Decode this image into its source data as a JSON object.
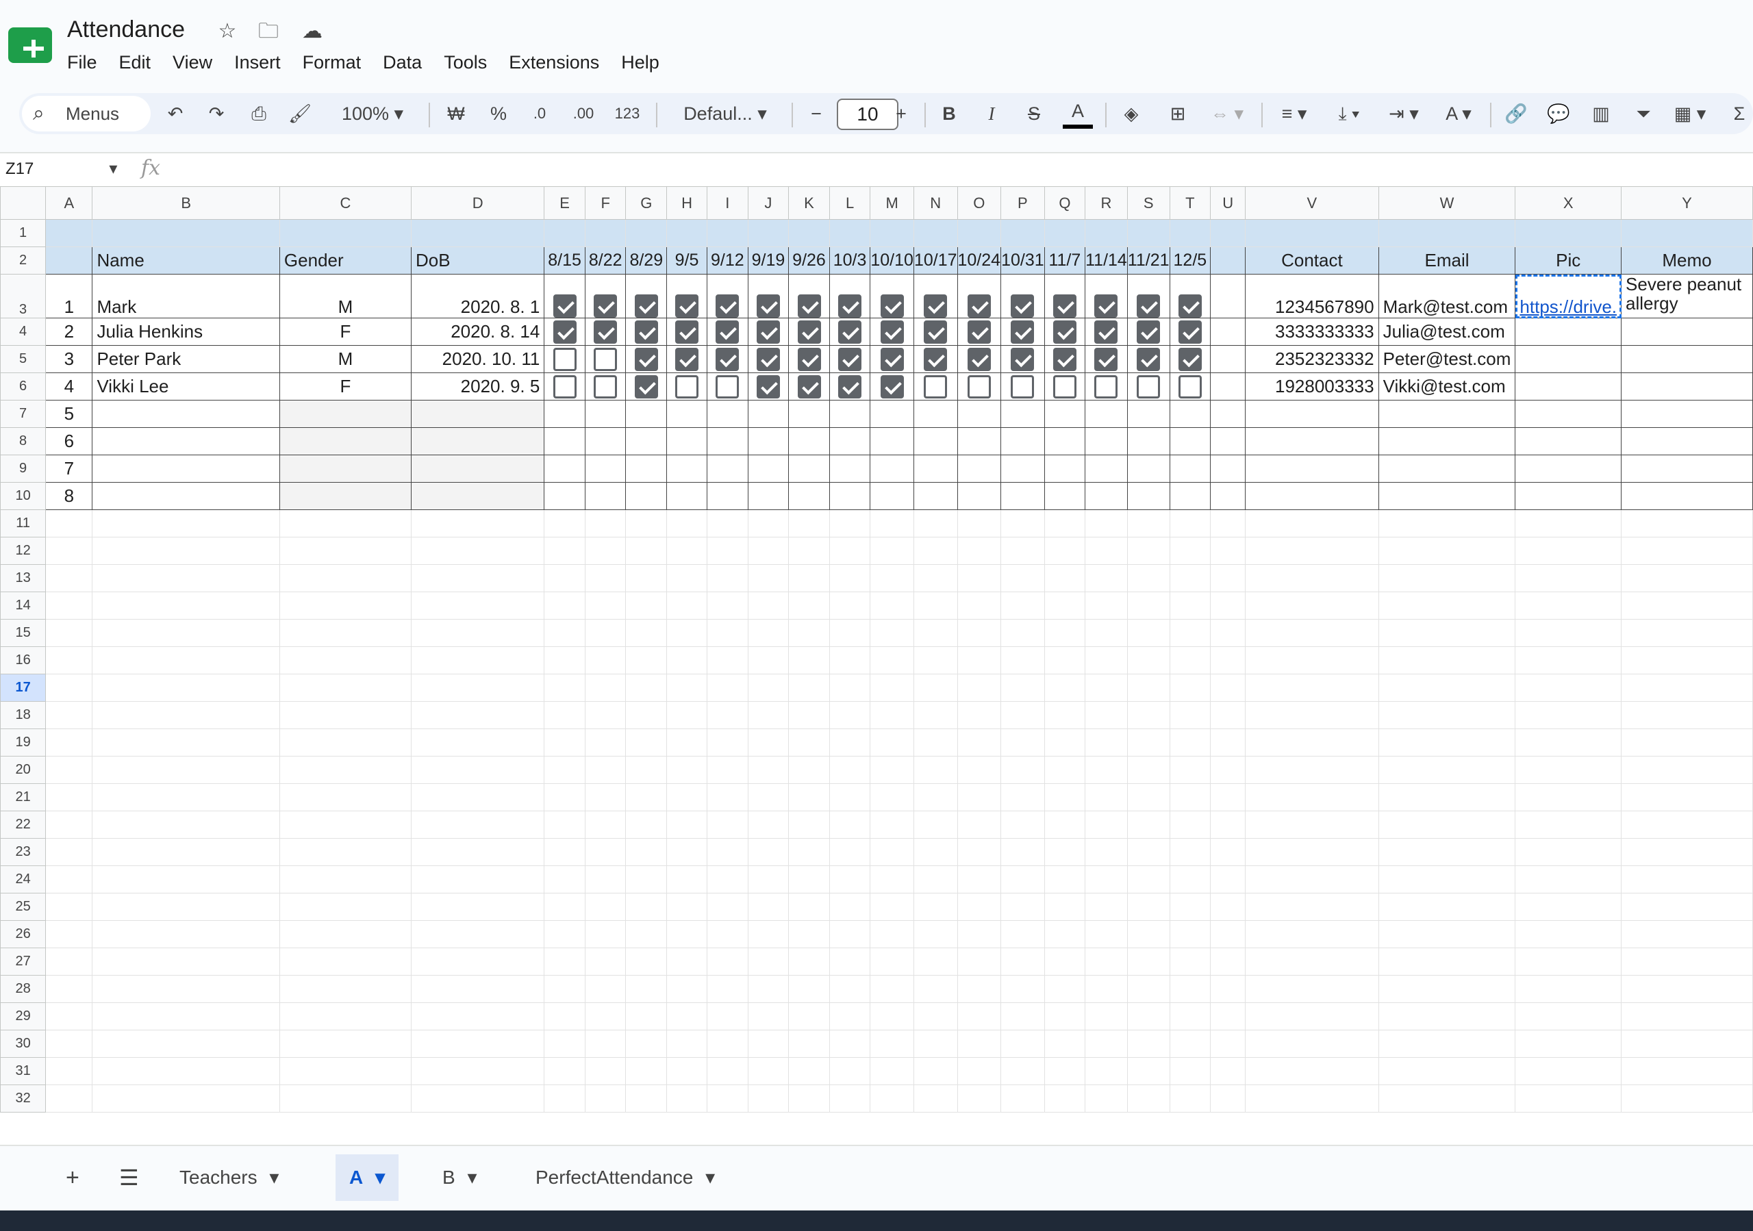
{
  "doc": {
    "title": "Attendance"
  },
  "menu": [
    "File",
    "Edit",
    "View",
    "Insert",
    "Format",
    "Data",
    "Tools",
    "Extensions",
    "Help"
  ],
  "toolbar": {
    "search": "Menus",
    "zoom": "100%",
    "currency": "₩",
    "percent": "%",
    "dec_less": ".0",
    "dec_more": ".00",
    "format_123": "123",
    "font": "Defaul...",
    "font_size": "10",
    "bold": "B",
    "italic": "I",
    "strike": "S",
    "text_color": "A"
  },
  "formula": {
    "cell_ref": "Z17",
    "fx": "fx"
  },
  "columns": [
    "A",
    "B",
    "C",
    "D",
    "E",
    "F",
    "G",
    "H",
    "I",
    "J",
    "K",
    "L",
    "M",
    "N",
    "O",
    "P",
    "Q",
    "R",
    "S",
    "T",
    "U",
    "V",
    "W",
    "X",
    "Y"
  ],
  "header": {
    "name": "Name",
    "gender": "Gender",
    "dob": "DoB",
    "dates": [
      "8/15",
      "8/22",
      "8/29",
      "9/5",
      "9/12",
      "9/19",
      "9/26",
      "10/3",
      "10/10",
      "10/17",
      "10/24",
      "10/31",
      "11/7",
      "11/14",
      "11/21",
      "12/5"
    ],
    "contact": "Contact",
    "email": "Email",
    "pic": "Pic",
    "memo": "Memo"
  },
  "students": [
    {
      "row": "3",
      "no": "1",
      "name": "Mark",
      "gender": "M",
      "dob": "2020. 8. 1",
      "att": [
        1,
        1,
        1,
        1,
        1,
        1,
        1,
        1,
        1,
        1,
        1,
        1,
        1,
        1,
        1,
        1
      ],
      "contact": "1234567890",
      "email": "Mark@test.com",
      "pic": "https://drive.",
      "memo": "Severe peanut allergy"
    },
    {
      "row": "4",
      "no": "2",
      "name": "Julia Henkins",
      "gender": "F",
      "dob": "2020. 8. 14",
      "att": [
        1,
        1,
        1,
        1,
        1,
        1,
        1,
        1,
        1,
        1,
        1,
        1,
        1,
        1,
        1,
        1
      ],
      "contact": "3333333333",
      "email": "Julia@test.com",
      "pic": "",
      "memo": ""
    },
    {
      "row": "5",
      "no": "3",
      "name": "Peter Park",
      "gender": "M",
      "dob": "2020. 10. 11",
      "att": [
        0,
        0,
        1,
        1,
        1,
        1,
        1,
        1,
        1,
        1,
        1,
        1,
        1,
        1,
        1,
        1
      ],
      "contact": "2352323332",
      "email": "Peter@test.com",
      "pic": "",
      "memo": ""
    },
    {
      "row": "6",
      "no": "4",
      "name": "Vikki Lee",
      "gender": "F",
      "dob": "2020. 9. 5",
      "att": [
        0,
        0,
        1,
        0,
        0,
        1,
        1,
        1,
        1,
        0,
        0,
        0,
        0,
        0,
        0,
        0
      ],
      "contact": "1928003333",
      "email": "Vikki@test.com",
      "pic": "",
      "memo": ""
    }
  ],
  "empty_rows": [
    {
      "row": "7",
      "no": "5"
    },
    {
      "row": "8",
      "no": "6"
    },
    {
      "row": "9",
      "no": "7"
    },
    {
      "row": "10",
      "no": "8"
    }
  ],
  "blank_rows": [
    "11",
    "12",
    "13",
    "14",
    "15",
    "16",
    "17",
    "18",
    "19",
    "20",
    "21",
    "22",
    "23",
    "24",
    "25",
    "26",
    "27",
    "28",
    "29",
    "30",
    "31",
    "32"
  ],
  "selected_row": "17",
  "sheets": [
    "Teachers",
    "A",
    "B",
    "PerfectAttendance"
  ],
  "active_sheet": "A"
}
